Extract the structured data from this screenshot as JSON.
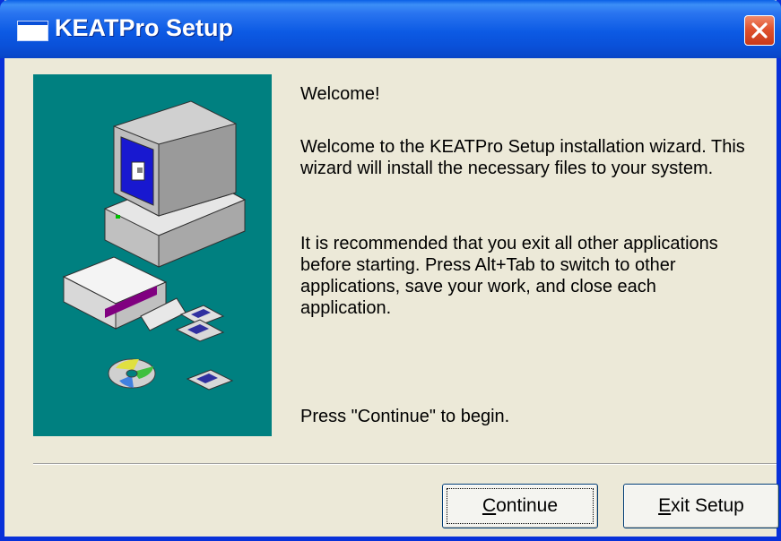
{
  "window": {
    "title": "KEATPro Setup"
  },
  "title_icon": "window-icon",
  "close_icon": "close-icon",
  "content": {
    "greeting": "Welcome!",
    "intro_line1": "Welcome to the KEATPro Setup installation wizard.  This",
    "intro_line2": "wizard will install the necessary files to your system.",
    "rec_line1": "It is recommended that you exit all other applications",
    "rec_line2": "before starting.  Press Alt+Tab to switch to other",
    "rec_line3": "applications, save your work, and close each",
    "rec_line4": "application.",
    "press": "Press \"Continue\" to begin."
  },
  "buttons": {
    "continue": {
      "accel": "C",
      "rest": "ontinue"
    },
    "exit": {
      "accel": "E",
      "rest": "xit Setup"
    }
  },
  "colors": {
    "title_bar": "#0a50d8",
    "panel_bg": "#008080",
    "dialog_bg": "#ece9d8",
    "close_button": "#e0522e"
  }
}
